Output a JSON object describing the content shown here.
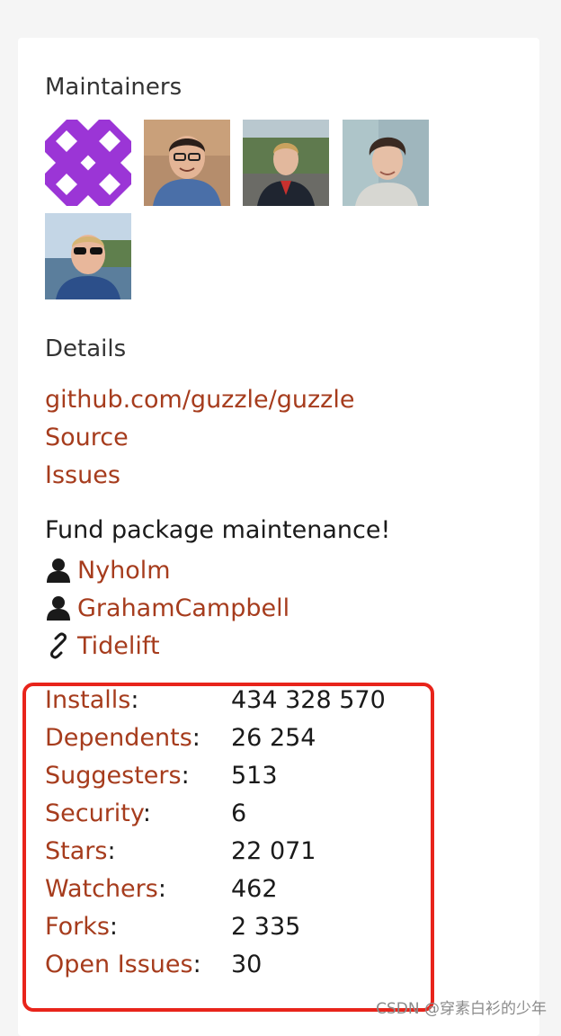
{
  "maintainers": {
    "title": "Maintainers",
    "avatars": [
      {
        "name": "identicon",
        "kind": "identicon",
        "color": "#9b35d6"
      },
      {
        "name": "maintainer-2",
        "kind": "photo",
        "color": "#b08a6a"
      },
      {
        "name": "maintainer-3",
        "kind": "photo",
        "color": "#6f7e6a"
      },
      {
        "name": "maintainer-4",
        "kind": "photo",
        "color": "#9bb0b7"
      },
      {
        "name": "maintainer-5",
        "kind": "photo",
        "color": "#7a98b8"
      }
    ]
  },
  "details": {
    "title": "Details",
    "repo_link": "github.com/guzzle/guzzle",
    "source_link": "Source",
    "issues_link": "Issues"
  },
  "fund": {
    "title": "Fund package maintenance!",
    "items": [
      {
        "label": "Nyholm",
        "icon": "user-icon"
      },
      {
        "label": "GrahamCampbell",
        "icon": "user-icon"
      },
      {
        "label": "Tidelift",
        "icon": "link-icon"
      }
    ]
  },
  "stats": [
    {
      "label": "Installs",
      "value": "434 328 570"
    },
    {
      "label": "Dependents",
      "value": "26 254"
    },
    {
      "label": "Suggesters",
      "value": "513"
    },
    {
      "label": "Security",
      "value": "6"
    },
    {
      "label": "Stars",
      "value": "22 071"
    },
    {
      "label": "Watchers",
      "value": "462"
    },
    {
      "label": "Forks",
      "value": "2 335"
    },
    {
      "label": "Open Issues",
      "value": "30"
    }
  ],
  "colors": {
    "link": "#a63c1d",
    "highlight": "#e8241b"
  },
  "watermark": "CSDN @穿素白衫的少年"
}
